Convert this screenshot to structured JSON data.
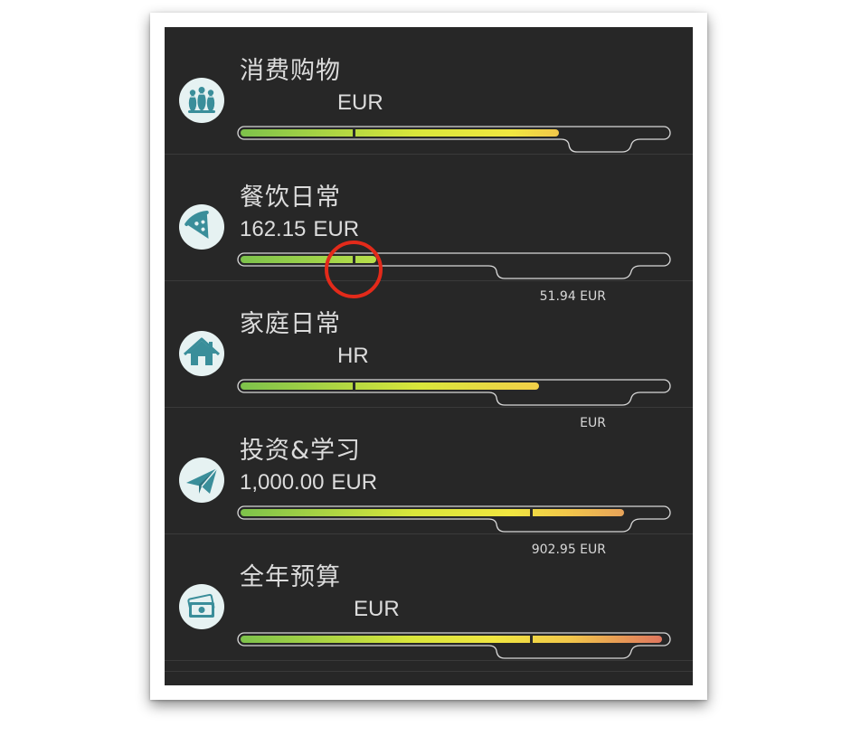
{
  "categories": [
    {
      "name": "消费购物",
      "amount": "",
      "currency": "EUR",
      "remaining": "",
      "fill": 0.75,
      "mark": 0.27,
      "icon": "bowling-pins-icon"
    },
    {
      "name": "餐饮日常",
      "amount": "162.15",
      "currency": "EUR",
      "remaining": "51.94 EUR",
      "fill": 0.32,
      "mark": 0.27,
      "icon": "pizza-slice-icon"
    },
    {
      "name": "家庭日常",
      "amount": "",
      "currency": "HR",
      "remaining": "EUR",
      "fill": 0.7,
      "mark": 0.27,
      "icon": "house-icon"
    },
    {
      "name": "投资&学习",
      "amount": "1,000.00",
      "currency": "EUR",
      "remaining": "902.95 EUR",
      "fill": 0.89,
      "mark": 0.68,
      "icon": "paper-plane-icon"
    },
    {
      "name": "全年预算",
      "amount": "",
      "currency": "EUR",
      "remaining": "",
      "fill": 0.98,
      "mark": 0.68,
      "icon": "money-bills-icon"
    }
  ],
  "colors": {
    "panel_bg": "#272727",
    "text": "#dcdcdc",
    "icon_bg": "#e6f2f2",
    "icon_fg": "#3a8e9a",
    "bar_green": "#7dc24b",
    "bar_yellow": "#f0e640",
    "bar_orange": "#e7a35a",
    "bar_red": "#e0765e",
    "highlight_circle": "#e32a1a"
  }
}
